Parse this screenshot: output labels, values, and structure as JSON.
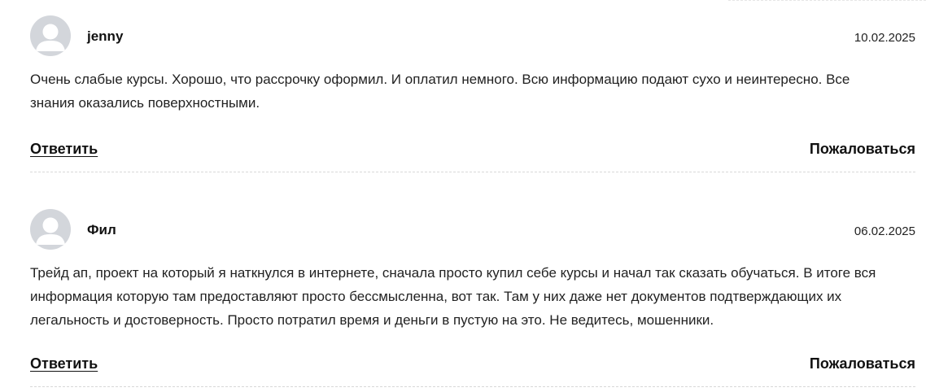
{
  "comments": [
    {
      "author": "jenny",
      "date": "10.02.2025",
      "text": "Очень слабые курсы. Хорошо, что рассрочку оформил. И оплатил немного. Всю информацию подают сухо и неинтересно. Все знания оказались поверхностными.",
      "reply_label": "Ответить",
      "report_label": "Пожаловаться",
      "avatar_icon": "user-silhouette-icon"
    },
    {
      "author": "Фил",
      "date": "06.02.2025",
      "text": "Трейд ап, проект на который я наткнулся в интернете, сначала просто купил себе курсы и начал так сказать обучаться. В итоге вся информация которую там предоставляют просто бессмысленна, вот так. Там у них даже нет документов подтверждающих их легальность и достоверность. Просто потратил время и деньги в пустую на это. Не ведитесь, мошенники.",
      "reply_label": "Ответить",
      "report_label": "Пожаловаться",
      "avatar_icon": "user-silhouette-icon"
    }
  ],
  "colors": {
    "avatar_bg": "#d3d6db",
    "avatar_fg": "#ffffff",
    "divider": "#d8d8d8",
    "text": "#222222"
  }
}
